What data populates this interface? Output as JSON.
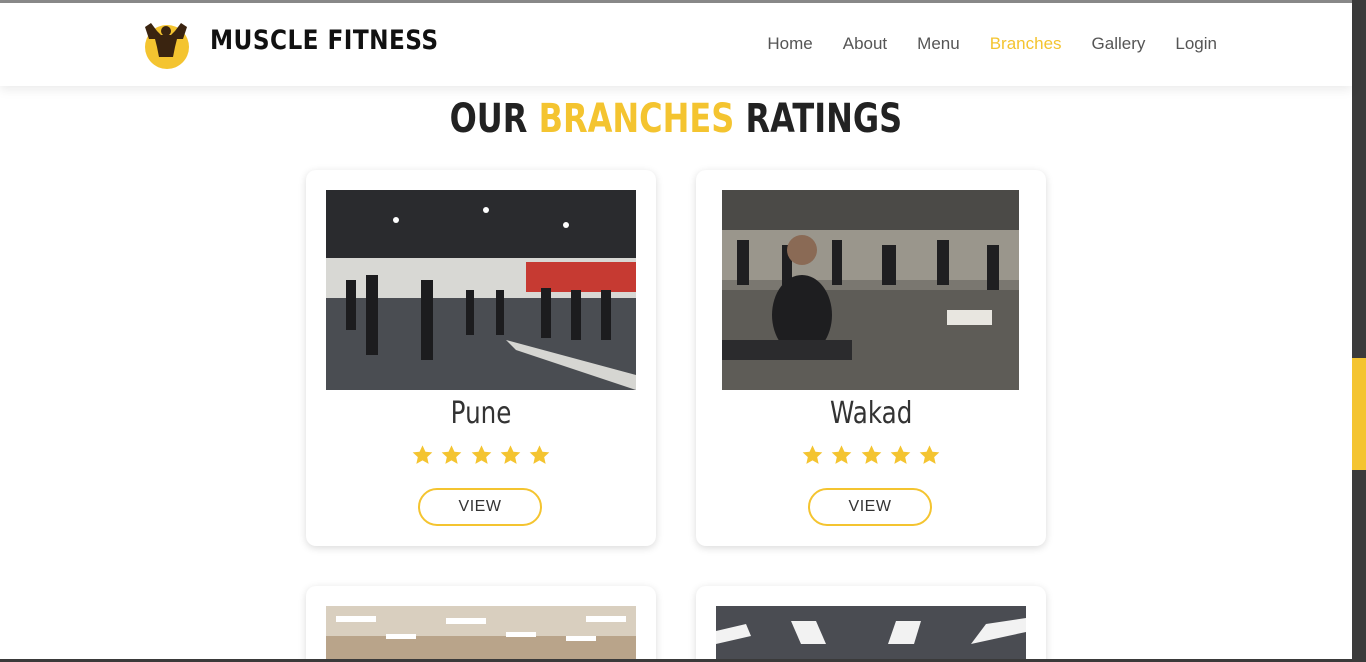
{
  "brand": {
    "name": "MUSCLE FITNESS",
    "logo": "bodybuilder-logo"
  },
  "nav": {
    "items": [
      "Home",
      "About",
      "Menu",
      "Branches",
      "Gallery",
      "Login"
    ],
    "active": "Branches"
  },
  "page": {
    "title_part1": "OUR",
    "title_accent": "BRANCHES",
    "title_part2": "RATINGS"
  },
  "branches": [
    {
      "name": "Pune",
      "rating": 5,
      "button": "VIEW"
    },
    {
      "name": "Wakad",
      "rating": 5,
      "button": "VIEW"
    }
  ],
  "colors": {
    "accent": "#f4c430",
    "text": "#333333",
    "scrollbar": "#3b3b3b"
  },
  "icons": {
    "star": "star-icon"
  }
}
